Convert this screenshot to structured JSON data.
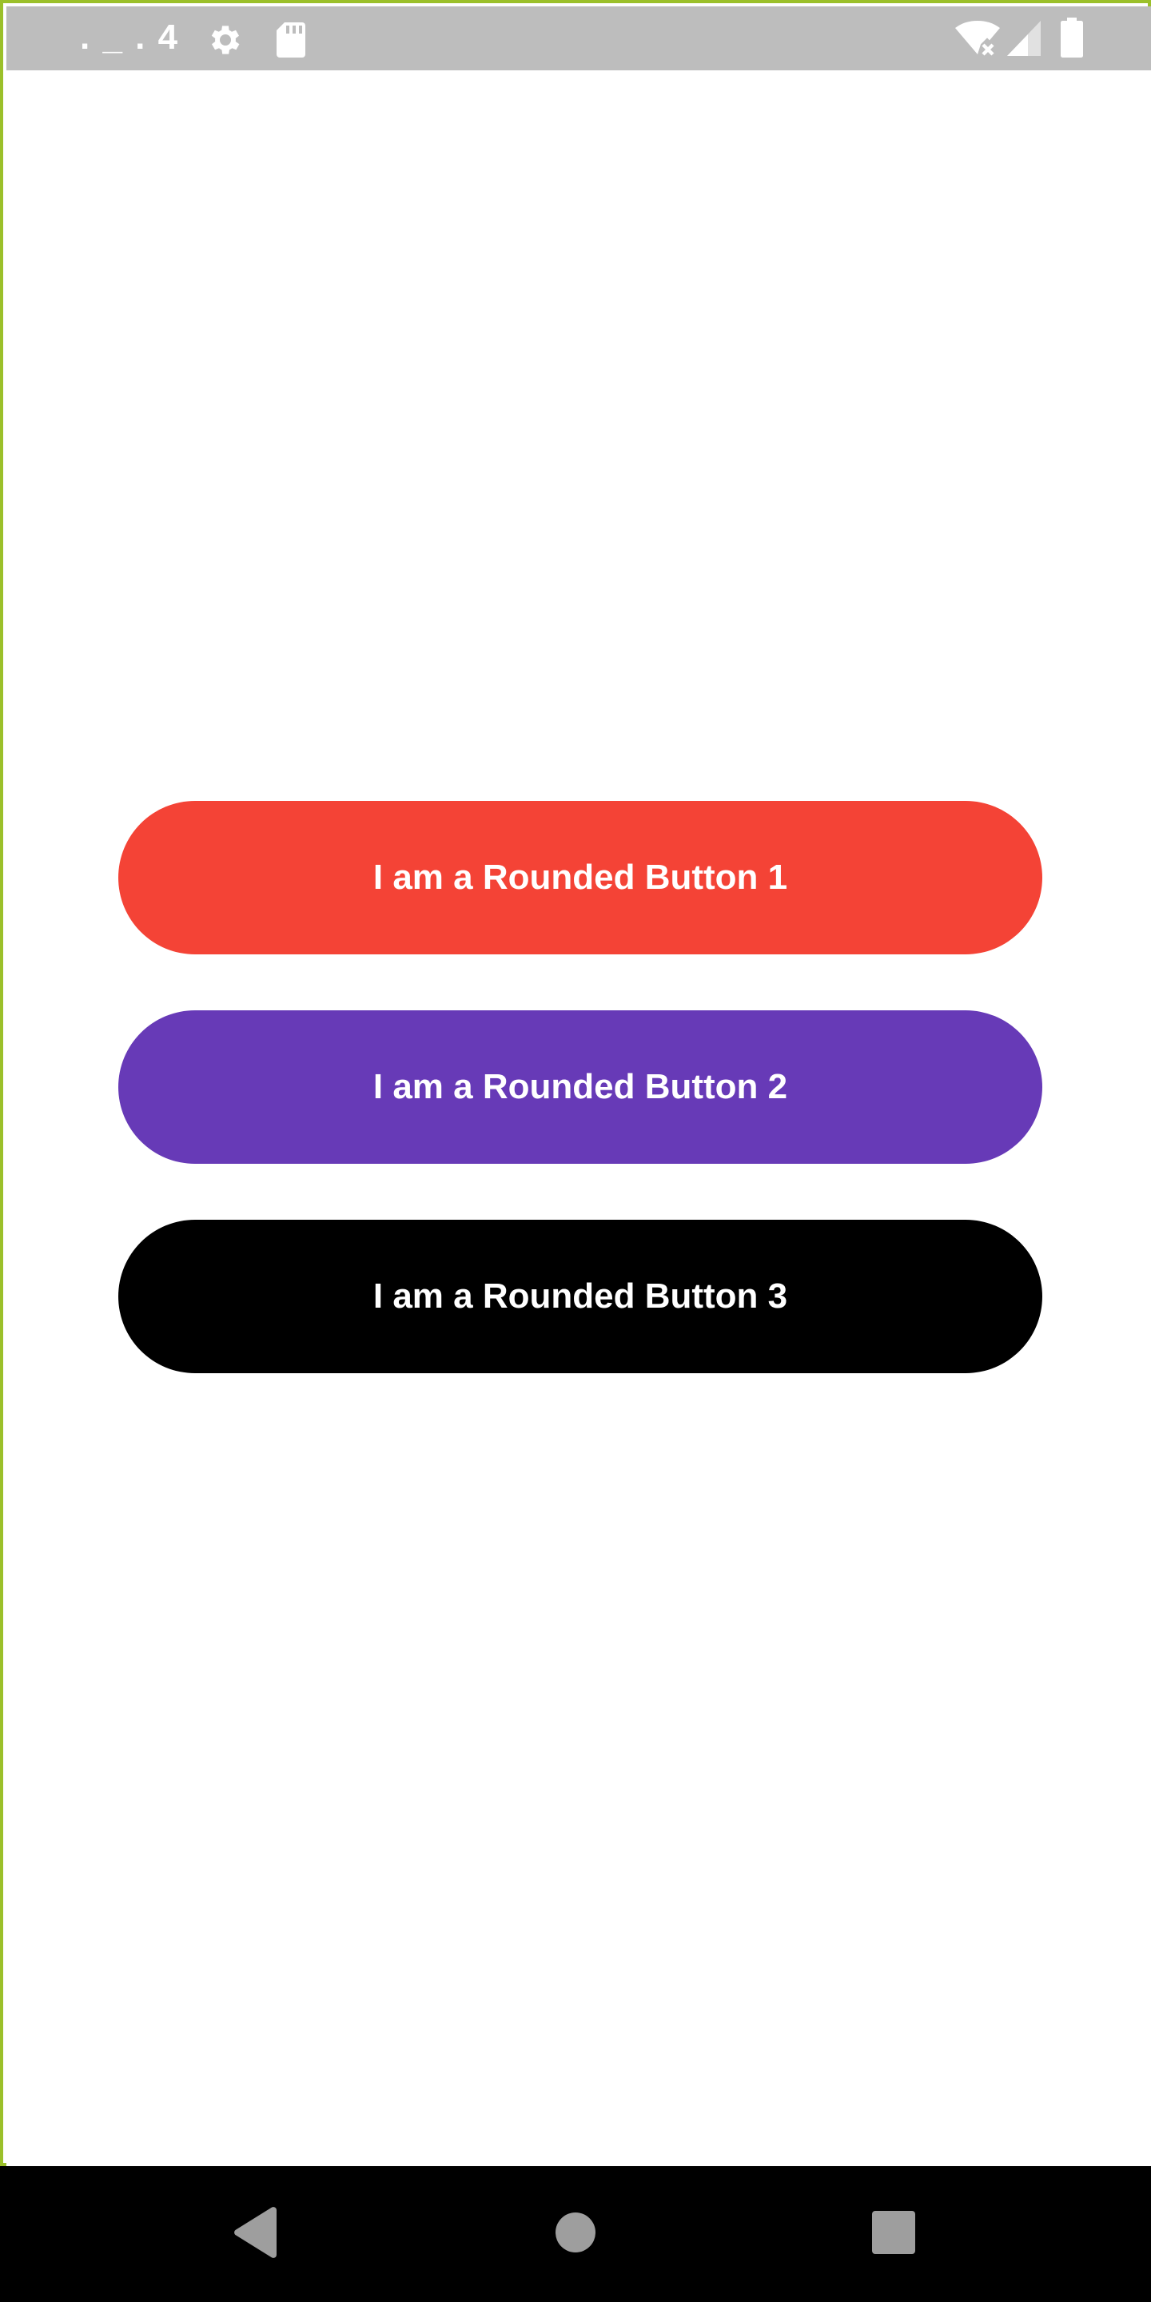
{
  "status_bar": {
    "time": ". _ . 4",
    "background": "#bdbdbd",
    "icons": [
      "settings-gear-icon",
      "sd-card-icon",
      "wifi-off-icon",
      "cellular-signal-icon",
      "battery-icon"
    ]
  },
  "buttons": [
    {
      "label": "I am a Rounded Button 1",
      "color": "#f44336"
    },
    {
      "label": "I am a Rounded Button 2",
      "color": "#673ab7"
    },
    {
      "label": "I am a Rounded Button 3",
      "color": "#000000"
    }
  ],
  "navigation_bar": {
    "icons": [
      "back-triangle-icon",
      "home-circle-icon",
      "recents-square-icon"
    ]
  }
}
